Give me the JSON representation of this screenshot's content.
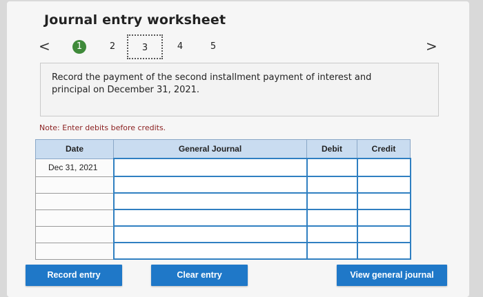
{
  "worksheet": {
    "title": "Journal entry worksheet",
    "prev_arrow": "<",
    "next_arrow": ">",
    "steps": [
      "1",
      "2",
      "3",
      "4",
      "5"
    ],
    "current_step": "3",
    "completed_step": "1"
  },
  "prompt": {
    "text": "Record the payment of the second installment payment of interest and principal on December 31, 2021."
  },
  "note": "Note: Enter debits before credits.",
  "table": {
    "headers": [
      "Date",
      "General Journal",
      "Debit",
      "Credit"
    ],
    "rows": [
      {
        "date": "Dec 31, 2021",
        "account": "",
        "debit": "",
        "credit": ""
      },
      {
        "date": "",
        "account": "",
        "debit": "",
        "credit": ""
      },
      {
        "date": "",
        "account": "",
        "debit": "",
        "credit": ""
      },
      {
        "date": "",
        "account": "",
        "debit": "",
        "credit": ""
      },
      {
        "date": "",
        "account": "",
        "debit": "",
        "credit": ""
      },
      {
        "date": "",
        "account": "",
        "debit": "",
        "credit": ""
      }
    ]
  },
  "buttons": {
    "record": "Record entry",
    "clear": "Clear entry",
    "view": "View general journal"
  },
  "colors": {
    "accent": "#1f78c8",
    "step_done": "#3f8a3a",
    "header_bg": "#c9dcf0",
    "note_text": "#8a1f1f"
  }
}
